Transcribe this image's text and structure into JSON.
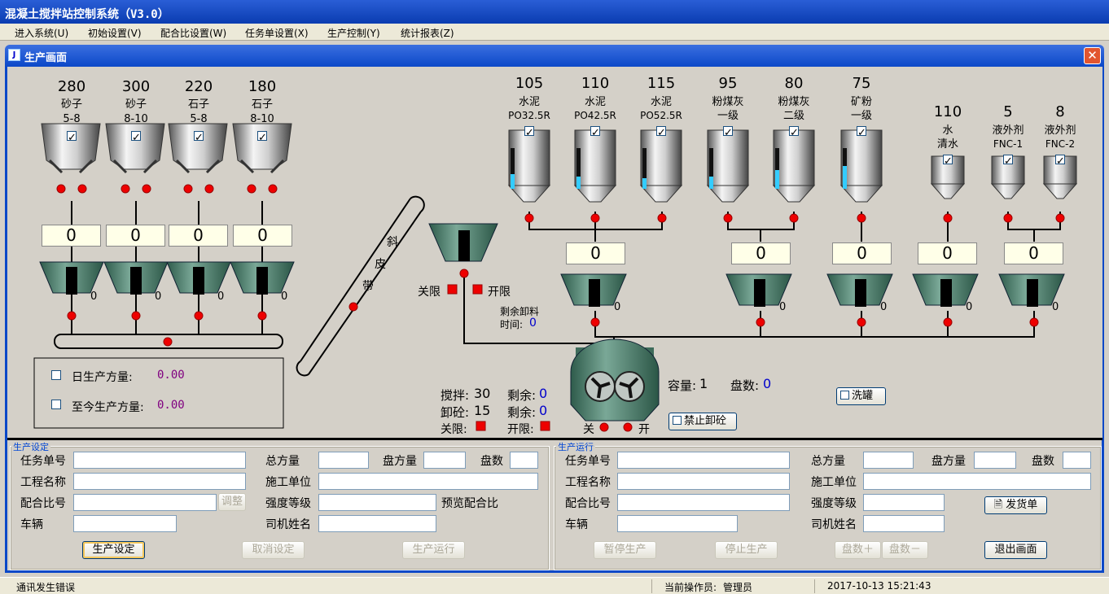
{
  "window": {
    "title": "混凝土搅拌站控制系统（V3.0）"
  },
  "menu": [
    "进入系统(U)",
    "初始设置(V)",
    "配合比设置(W)",
    "任务单设置(X)",
    "生产控制(Y)",
    "统计报表(Z)"
  ],
  "inner_window": {
    "title": "生产画面",
    "close": "✕"
  },
  "aggregates": [
    {
      "value": "280",
      "name": "砂子",
      "spec": "5-8",
      "weight": "0",
      "scale": "0"
    },
    {
      "value": "300",
      "name": "砂子",
      "spec": "8-10",
      "weight": "0",
      "scale": "0"
    },
    {
      "value": "220",
      "name": "石子",
      "spec": "5-8",
      "weight": "0",
      "scale": "0"
    },
    {
      "value": "180",
      "name": "石子",
      "spec": "8-10",
      "weight": "0",
      "scale": "0"
    }
  ],
  "silos": [
    {
      "value": "105",
      "name": "水泥",
      "spec": "PO32.5R",
      "fill": 0.35
    },
    {
      "value": "110",
      "name": "水泥",
      "spec": "PO42.5R",
      "fill": 0.3
    },
    {
      "value": "115",
      "name": "水泥",
      "spec": "PO52.5R",
      "fill": 0.25
    },
    {
      "value": "95",
      "name": "粉煤灰",
      "spec": "一级",
      "fill": 0.3
    },
    {
      "value": "80",
      "name": "粉煤灰",
      "spec": "二级",
      "fill": 0.45
    },
    {
      "value": "75",
      "name": "矿粉",
      "spec": "一级",
      "fill": 0.55
    }
  ],
  "tanks": [
    {
      "value": "110",
      "name": "水",
      "spec": "清水"
    },
    {
      "value": "5",
      "name": "液外剂",
      "spec": "FNC-1"
    },
    {
      "value": "8",
      "name": "液外剂",
      "spec": "FNC-2"
    }
  ],
  "hoppers": {
    "cement": "0",
    "flyash": "0",
    "mineral": "0",
    "water": "0",
    "additive": "0"
  },
  "belt_label": [
    "斜",
    "皮",
    "带"
  ],
  "waiting_hopper": {
    "close_limit": "关限",
    "open_limit": "开限",
    "remaining_label": "剩余卸料",
    "time_label": "时间:",
    "time_value": "0"
  },
  "mixer": {
    "stir_label": "搅拌:",
    "stir_value": "30",
    "remain1_label": "剩余:",
    "remain1_value": "0",
    "discharge_label": "卸砼:",
    "discharge_value": "15",
    "remain2_label": "剩余:",
    "remain2_value": "0",
    "close_limit": "关限:",
    "open_limit": "开限:",
    "off": "关",
    "on": "开",
    "capacity_label": "容量:",
    "capacity_value": "1",
    "batches_label": "盘数:",
    "batches_value": "0",
    "no_discharge": "禁止卸砼",
    "wash": "洗罐"
  },
  "production": {
    "daily_label": "日生产方量:",
    "daily_value": "0.00",
    "total_label": "至今生产方量:",
    "total_value": "0.00"
  },
  "setup": {
    "legend": "生产设定",
    "task_no": "任务单号",
    "project": "工程名称",
    "mix_no": "配合比号",
    "vehicle": "车辆",
    "total": "总方量",
    "batch_vol": "盘方量",
    "batches": "盘数",
    "builder": "施工单位",
    "strength": "强度等级",
    "preview": "预览配合比",
    "driver": "司机姓名",
    "adjust": "调整",
    "btn_set": "生产设定",
    "btn_cancel": "取消设定",
    "btn_run": "生产运行"
  },
  "running": {
    "legend": "生产运行",
    "task_no": "任务单号",
    "project": "工程名称",
    "mix_no": "配合比号",
    "vehicle": "车辆",
    "total": "总方量",
    "batch_vol": "盘方量",
    "batches": "盘数",
    "builder": "施工单位",
    "strength": "强度等级",
    "driver": "司机姓名",
    "delivery": "发货单",
    "btn_pause": "暂停生产",
    "btn_stop": "停止生产",
    "btn_plus": "盘数＋",
    "btn_minus": "盘数－",
    "btn_exit": "退出画面"
  },
  "status": {
    "msg": "通讯发生错误",
    "operator_label": "当前操作员:",
    "operator": "管理员",
    "datetime": "2017-10-13  15:21:43"
  }
}
